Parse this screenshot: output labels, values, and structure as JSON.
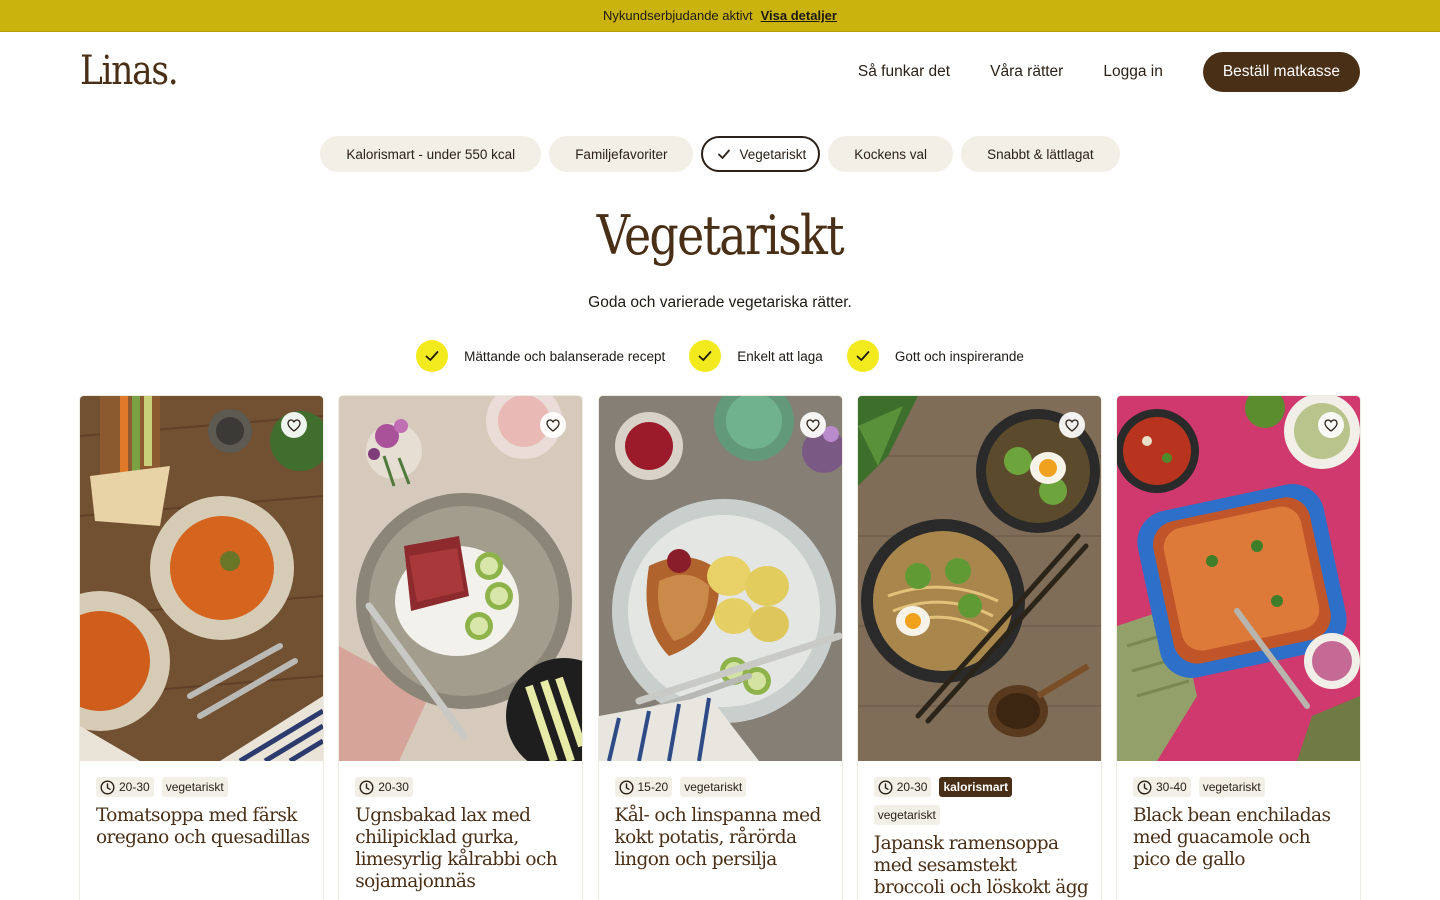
{
  "promo": {
    "text": "Nykundserbjudande aktivt",
    "link": "Visa detaljer"
  },
  "header": {
    "logo": "Linas.",
    "nav": [
      "Så funkar det",
      "Våra rätter",
      "Logga in"
    ],
    "cta": "Beställ matkasse"
  },
  "filters": [
    {
      "label": "Kalorismart - under 550 kcal",
      "active": false
    },
    {
      "label": "Familjefavoriter",
      "active": false
    },
    {
      "label": "Vegetariskt",
      "active": true
    },
    {
      "label": "Kockens val",
      "active": false
    },
    {
      "label": "Snabbt & lättlagat",
      "active": false
    }
  ],
  "page": {
    "title": "Vegetariskt",
    "subtitle": "Goda och varierade vegetariska rätter."
  },
  "benefits": [
    "Mättande och balanserade recept",
    "Enkelt att laga",
    "Gott och inspirerande"
  ],
  "recipes": [
    {
      "time": "20-30",
      "tags": [
        "vegetariskt"
      ],
      "name": "Tomatsoppa med färsk oregano och quesadillas"
    },
    {
      "time": "20-30",
      "tags": [],
      "name": "Ugnsbakad lax med chilipicklad gurka, limesyrlig kålrabbi och sojamajonnäs"
    },
    {
      "time": "15-20",
      "tags": [
        "vegetariskt"
      ],
      "name": "Kål- och linspanna med kokt potatis, rårörda lingon och persilja"
    },
    {
      "time": "20-30",
      "badge": "kalorismart",
      "tags": [
        "vegetariskt"
      ],
      "name": "Japansk ramensoppa med sesamstekt broccoli och löskokt ägg"
    },
    {
      "time": "30-40",
      "tags": [
        "vegetariskt"
      ],
      "name": "Black bean enchiladas med guacamole och pico de gallo"
    }
  ],
  "colors": {
    "promo": "#cbb30e",
    "brand": "#4a2f17",
    "chip": "#f2efe6",
    "check": "#f2ea1c"
  }
}
